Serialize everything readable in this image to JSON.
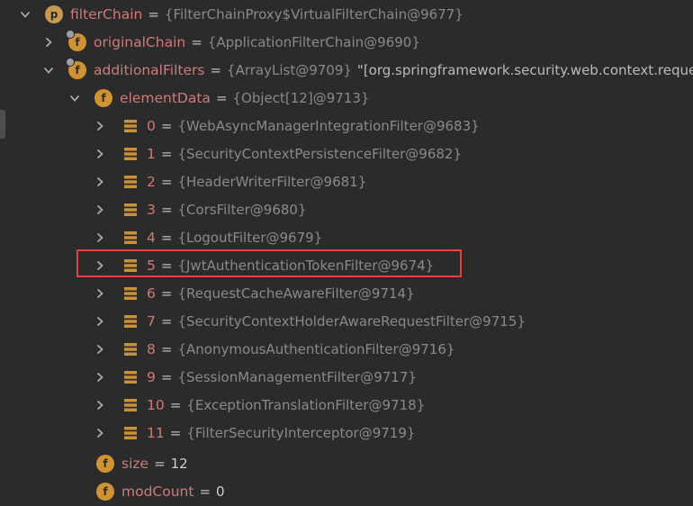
{
  "root": {
    "name": "filterChain",
    "value": "{FilterChainProxy$VirtualFilterChain@9677}"
  },
  "original_chain": {
    "name": "originalChain",
    "value": "{ApplicationFilterChain@9690}"
  },
  "additional_filters": {
    "name": "additionalFilters",
    "value": "{ArrayList@9709}",
    "string_value": "\"[org.springframework.security.web.context.request."
  },
  "element_data": {
    "name": "elementData",
    "value": "{Object[12]@9713}"
  },
  "elements": [
    {
      "index": "0",
      "value": "{WebAsyncManagerIntegrationFilter@9683}"
    },
    {
      "index": "1",
      "value": "{SecurityContextPersistenceFilter@9682}"
    },
    {
      "index": "2",
      "value": "{HeaderWriterFilter@9681}"
    },
    {
      "index": "3",
      "value": "{CorsFilter@9680}"
    },
    {
      "index": "4",
      "value": "{LogoutFilter@9679}"
    },
    {
      "index": "5",
      "value": "{JwtAuthenticationTokenFilter@9674}"
    },
    {
      "index": "6",
      "value": "{RequestCacheAwareFilter@9714}"
    },
    {
      "index": "7",
      "value": "{SecurityContextHolderAwareRequestFilter@9715}"
    },
    {
      "index": "8",
      "value": "{AnonymousAuthenticationFilter@9716}"
    },
    {
      "index": "9",
      "value": "{SessionManagementFilter@9717}"
    },
    {
      "index": "10",
      "value": "{ExceptionTranslationFilter@9718}"
    },
    {
      "index": "11",
      "value": "{FilterSecurityInterceptor@9719}"
    }
  ],
  "size_field": {
    "name": "size",
    "value": "12"
  },
  "mod_count_field": {
    "name": "modCount",
    "value": "0"
  },
  "icons": {
    "expand": "chevron-down-icon",
    "collapse": "chevron-right-icon",
    "property": "property-p-icon",
    "field": "field-f-icon",
    "array_element": "array-element-icon"
  },
  "colors": {
    "background": "#2b2b2b",
    "name": "#d07a78",
    "value": "#8a8a8a",
    "highlight": "#e5413e",
    "badge": "#d0932f"
  }
}
